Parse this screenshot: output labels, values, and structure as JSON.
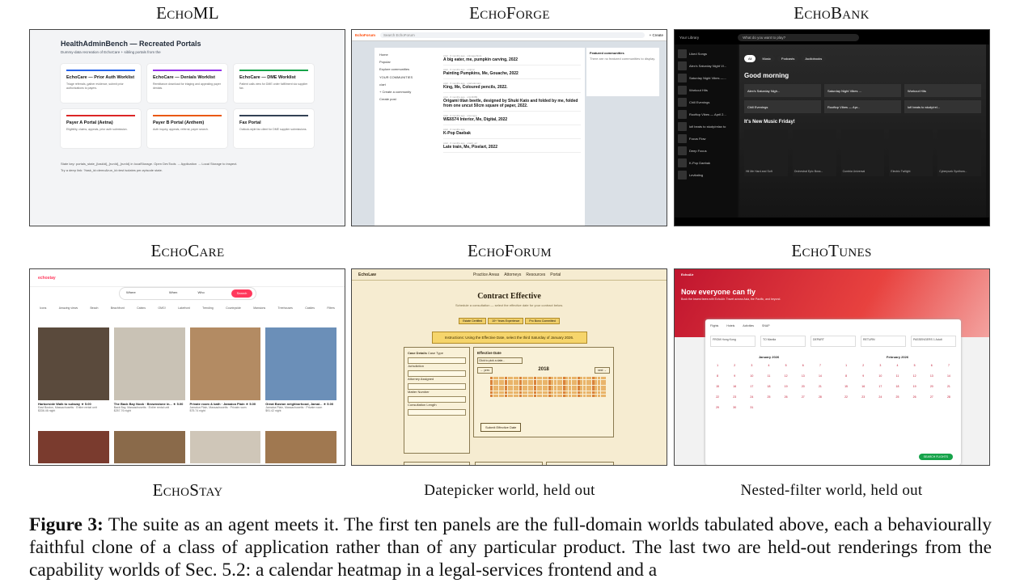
{
  "labels": {
    "echoml": "EchoML",
    "echoforge": "EchoForge",
    "echobank": "EchoBank",
    "echocare": "EchoCare",
    "echoforum": "EchoForum",
    "echotunes": "EchoTunes",
    "echostay": "EchoStay",
    "datepicker": "Datepicker world, held out",
    "nested": "Nested-filter world, held out"
  },
  "panel_ml": {
    "title": "HealthAdminBench — Recreated Portals",
    "subtitle": "Dummy-data recreation of EchoCare + sibling portals from the",
    "cards": [
      {
        "name": "EchoCare — Prior Auth Worklist",
        "desc": "Triage referrals, gather evidence, submit prior authorizations to payers.",
        "color": "#2563eb"
      },
      {
        "name": "EchoCare — Denials Worklist",
        "desc": "Remittance download for triaging and appealing payer denials.",
        "color": "#9333ea"
      },
      {
        "name": "EchoCare — DME Worklist",
        "desc": "Patient calls view for DME order fulfillment via supplier fax.",
        "color": "#16a34a"
      },
      {
        "name": "Payer A Portal (Aetna)",
        "desc": "Eligibility, claims, appeals, prior auth submission.",
        "color": "#dc2626"
      },
      {
        "name": "Payer B Portal (Anthem)",
        "desc": "Auth inquiry, appeals, referral, payer search.",
        "color": "#ea580c"
      },
      {
        "name": "Fax Portal",
        "desc": "Outlook-style fax client for DME supplier submissions.",
        "color": "#334155"
      }
    ],
    "foot1": "State key: portals_state_{taskId}_{runId}_{runId} in localStorage. Open DevTools → Application → Local Storage to inspect.",
    "foot2": "Try a deep link: ?task_id=demo&run_id=test isolates per-episode state."
  },
  "panel_forge": {
    "logo": "EchoForum",
    "search": "Search EchoForum",
    "create": "+ Create",
    "side": [
      "Home",
      "Popular",
      "Explore communities",
      "YOUR COMMUNITIES",
      "c/art",
      "+ Create a community",
      "Create post"
    ],
    "posts": [
      {
        "title": "A big eater, me, pumpkin carving, 2022",
        "meta": "c/art · 6 months ago · u/imagerfinds"
      },
      {
        "title": "Painting Pumpkins, Me, Gouache, 2022",
        "meta": "c/art · 6 months ago · u/njtmc"
      },
      {
        "title": "King, Me, Coloured pencils, 2022.",
        "meta": "c/art · 6 months ago · u/artsdomain"
      },
      {
        "title": "Origami titan beetle, designed by Shuki Kato and folded by me, folded from one uncut 50cm square of paper, 2022.",
        "meta": "c/art · 6 months ago · u/HJ3389"
      },
      {
        "title": "WE6574 Interior, Me, Digital, 2022",
        "meta": "c/art · 6 months ago · u/comgig"
      },
      {
        "title": "K-Pop Daebak",
        "meta": "c/art · 6 months ago"
      },
      {
        "title": "Late train, Me, Pixelart, 2022",
        "meta": "c/art · 6 months ago · u/add_art"
      }
    ],
    "right_title": "Featured communities",
    "right_text": "There are no featured communities to display."
  },
  "panel_bank": {
    "lib_title": "Your Library",
    "search": "What do you want to play?",
    "chips": [
      "All",
      "Music",
      "Podcasts",
      "Audiobooks"
    ],
    "lib": [
      "Liked Songs",
      "Alex's Saturday Night Vi...",
      "Saturday Night Vibes —...",
      "Workout Hits",
      "Chill Evenings",
      "Rooftop Vibes — April 2...",
      "lofi beats to study/relax to",
      "Focus Flow",
      "Deep Focus",
      "K-Pop Daebak",
      "Levitating"
    ],
    "greeting": "Good morning",
    "tiles": [
      "Alex's Saturday Nigh...",
      "Saturday Night Vibes ...",
      "Workout Hits",
      "Chill Evenings",
      "Rooftop Vibes — Apr...",
      "lofi beats to study/rel..."
    ],
    "new_music": "It's New Music Friday!",
    "show_all": "Show all",
    "albums": [
      "Hit Me Hard and Soft",
      "Orchestral Epic Boss...",
      "Cumbia Universal",
      "Electric Twilight",
      "Cyberpunk Synthwa..."
    ]
  },
  "panel_stay": {
    "logo": "echostay",
    "where": "Where",
    "when": "When",
    "who": "Who",
    "search": "Search",
    "cats": [
      "Icons",
      "Amazing views",
      "Beach",
      "Beachfront",
      "Cabins",
      "OMG!",
      "Lakefront",
      "Trending",
      "Countryside",
      "Mansions",
      "Treehouses",
      "Castles",
      "Filters"
    ],
    "listings": [
      {
        "title": "Harborside Walk to subway",
        "sub": "East Boston, Massachusetts · Entire rental unit",
        "price": "$336.46 night",
        "rating": "★ 5.00",
        "color": "#5a4a3c"
      },
      {
        "title": "The Back Bay Nook · Brownstone in...",
        "sub": "Back Bay, Massachusetts · Entire rental unit",
        "price": "$257.76 night",
        "rating": "★ 5.00",
        "color": "#c9c2b5"
      },
      {
        "title": "Private room & bath · Jamaica Plain",
        "sub": "Jamaica Plain, Massachusetts · Private room",
        "price": "$75.74 night",
        "rating": "★ 5.00",
        "color": "#b38b63"
      },
      {
        "title": "Great Boston neighborhood, Jamai...",
        "sub": "Jamaica Plain, Massachusetts · Private room",
        "price": "$91.42 night",
        "rating": "★ 5.00",
        "color": "#6b8fb8"
      },
      {
        "color": "#7a3b2e"
      },
      {
        "color": "#8a6a4a"
      },
      {
        "color": "#cfc6b8"
      },
      {
        "color": "#a07850"
      }
    ]
  },
  "panel_law": {
    "brand": "EchoLaw",
    "nav": [
      "Practice Areas",
      "Attorneys",
      "Resources",
      "Portal"
    ],
    "title": "Contract Effective",
    "sub": "Schedule a consultation — select the effective date for your contract below.",
    "tags": [
      "Estate Certified",
      "10+ Years Experience",
      "Pro Bono Committed"
    ],
    "instr": "Instructions: Using the Effective Date, select the third Saturday of January 2026.",
    "case_title": "Case Details",
    "case_fields": [
      "Case Type",
      "Jurisdiction",
      "Attorney Assigned",
      "Matter Number",
      "Consultation Length"
    ],
    "date_title": "Effective Date",
    "click_hint": "Click to pick a date...",
    "prev": "← prev",
    "next": "next →",
    "year": "2018",
    "submit": "Submit Effective Date"
  },
  "panel_air": {
    "brand": "EchoAir",
    "title": "Now everyone can fly",
    "sub": "Book the lowest fares with EchoAir. Travel across Asia, the Pacific, and beyond.",
    "tabs": [
      "Flights",
      "Hotels",
      "Activities",
      "SNAP"
    ],
    "fields": [
      "FROM Hong Kong",
      "TO Manila",
      "DEPART",
      "RETURN",
      "PASSENGERS 1 Adult"
    ],
    "month1": "January 2026",
    "month2": "February 2026",
    "go": "SEARCH FLIGHTS"
  },
  "caption": {
    "lead": "Figure 3:",
    "text": "The suite as an agent meets it. The first ten panels are the full-domain worlds tabulated above, each a behaviourally faithful clone of a class of application rather than of any particular product. The last two are held-out renderings from the capability worlds of Sec. 5.2: a calendar heatmap in a legal-services frontend and a"
  }
}
